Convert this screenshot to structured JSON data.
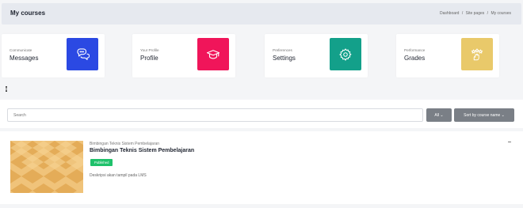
{
  "header": {
    "title": "My courses",
    "breadcrumb": [
      "Dashboard",
      "Site pages",
      "My courses"
    ],
    "separator": "/"
  },
  "cards": [
    {
      "small": "Communicate",
      "big": "Messages",
      "color": "#2b49e3",
      "icon": "chat-bubbles-icon"
    },
    {
      "small": "Your Profile",
      "big": "Profile",
      "color": "#f0155a",
      "icon": "graduation-cap-icon"
    },
    {
      "small": "Preferences",
      "big": "Settings",
      "color": "#13a08a",
      "icon": "gear-icon"
    },
    {
      "small": "Performance",
      "big": "Grades",
      "color": "#e9c96a",
      "icon": "stars-icon"
    }
  ],
  "filters": {
    "search_placeholder": "Search",
    "all_label": "All ⌄",
    "sort_label": "Sort by course name ⌄"
  },
  "course": {
    "category": "Bimbingan Teknis Sistem Pembelajaran",
    "name": "Bimbingan Teknis Sistem Pembelajaran",
    "status": "Published",
    "status_color": "#1fc16b",
    "description": "Deskripsi akan tampil pada LMS",
    "menu_label": "..."
  }
}
